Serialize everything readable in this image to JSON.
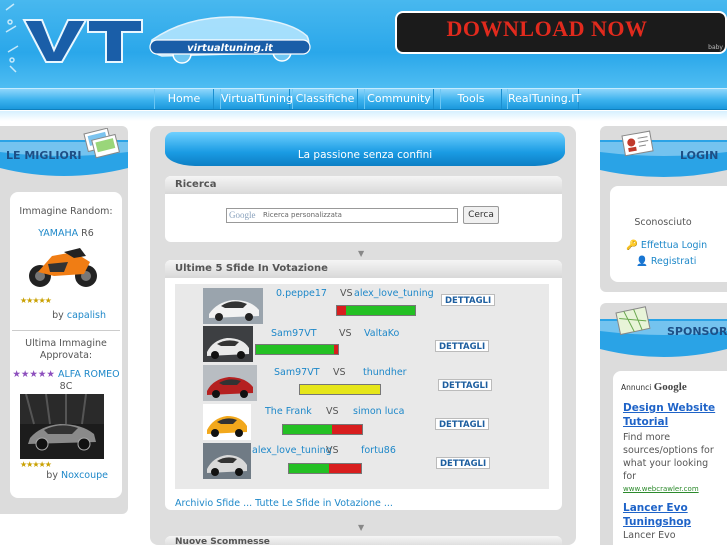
{
  "header": {
    "logo_text": "virtualtuning.it",
    "banner_text": "DOWNLOAD NOW",
    "banner_ad_tag": "baby"
  },
  "nav": {
    "items": [
      "Home",
      "VirtualTuning",
      "Classifiche",
      "Community",
      "Tools",
      "RealTuning.IT"
    ]
  },
  "left": {
    "title": "LE MIGLIORI",
    "random_label": "Immagine Random:",
    "car1_name": "YAMAHA",
    "car1_model": "R6",
    "car1_stars": "★★★★★",
    "car1_by_prefix": "by",
    "car1_by": "capalish",
    "last_label": "Ultima Immagine Approvata:",
    "car2_stars_top": "★★★★★",
    "car2_name": "ALFA ROMEO",
    "car2_model": "8C",
    "car2_stars": "★★★★★",
    "car2_by_prefix": "by",
    "car2_by": "Noxcoupe"
  },
  "center": {
    "tagline": "La passione senza confini",
    "search_title": "Ricerca",
    "search_logo": "Google",
    "search_placeholder": "Ricerca personalizzata",
    "search_button": "Cerca",
    "votes_title": "Ultime 5 Sfide In Votazione",
    "details_label": "DETTAGLI",
    "vs_label": "VS",
    "challenges": [
      {
        "p1": "0.peppe17",
        "p2": "alex_love_tuning",
        "votes_red": 0.12,
        "votes_green": 0.88
      },
      {
        "p1": "Sam97VT",
        "p2": "ValtaKo",
        "votes_red": 0.05,
        "votes_green": 0.95
      },
      {
        "p1": "Sam97VT",
        "p2": "thundher",
        "votes_red": 0.0,
        "votes_green": 1.0
      },
      {
        "p1": "The Frank",
        "p2": "simon luca",
        "votes_red": 0.38,
        "votes_green": 0.62
      },
      {
        "p1": "alex_love_tuning",
        "p2": "fortu86",
        "votes_red": 0.45,
        "votes_green": 0.55
      }
    ],
    "archive_text": "Archivio Sfide ... Tutte Le Sfide in Votazione ...",
    "next_title": "Nuove Scommesse"
  },
  "right": {
    "login_title": "LOGIN",
    "user_status": "Sconosciuto",
    "login_link": "Effettua Login",
    "register_link": "Registrati",
    "sponsor_title": "SPONSOR",
    "annunci_prefix": "Annunci",
    "annunci_brand": "Google",
    "ad1_title": "Design Website Tutorial",
    "ad1_text": "Find more sources/options for what your looking for",
    "ad1_url": "www.webcrawler.com",
    "ad2_title": "Lancer Evo Tuningshop",
    "ad2_text": "Lancer Evo"
  },
  "colors": {
    "accent_blue": "#1e88c9",
    "header_blue": "#2aa7ea",
    "vote_red": "#d81e1e",
    "vote_green": "#24c024",
    "vote_yellow": "#e6e61a",
    "banner_red": "#e12a1d"
  }
}
